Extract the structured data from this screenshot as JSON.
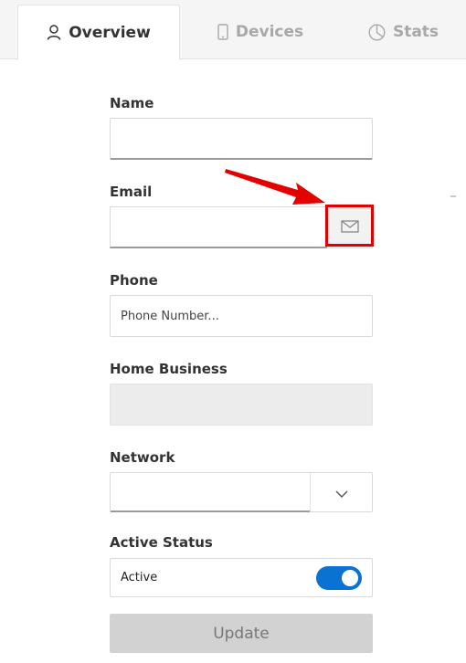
{
  "tabs": [
    {
      "label": "Overview",
      "icon": "user-icon",
      "active": true
    },
    {
      "label": "Devices",
      "icon": "phone-device-icon",
      "active": false
    },
    {
      "label": "Stats",
      "icon": "pie-chart-icon",
      "active": false
    }
  ],
  "form": {
    "name": {
      "label": "Name",
      "value": ""
    },
    "email": {
      "label": "Email",
      "value": "",
      "addon_icon": "envelope-icon"
    },
    "phone": {
      "label": "Phone",
      "placeholder": "Phone Number...",
      "value": ""
    },
    "home_business": {
      "label": "Home Business",
      "value": ""
    },
    "network": {
      "label": "Network",
      "value": ""
    },
    "active_status": {
      "label": "Active Status",
      "text": "Active",
      "enabled": true
    }
  },
  "update_label": "Update",
  "colors": {
    "toggle_on": "#0a72d1",
    "highlight": "#e00000",
    "disabled_button": "#d2d2d2"
  }
}
